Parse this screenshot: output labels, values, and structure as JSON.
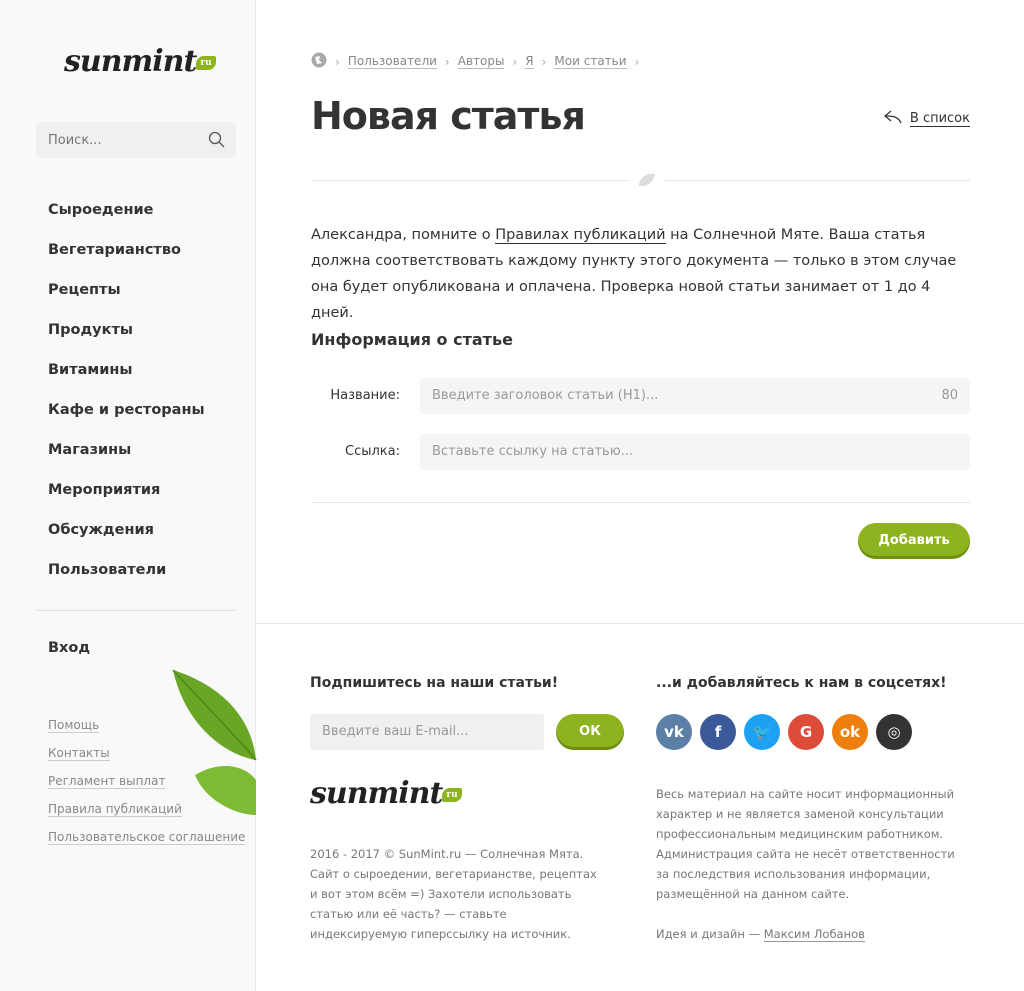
{
  "sidebar": {
    "logo": "sunmint",
    "logo_badge": "ru",
    "search_placeholder": "Поиск...",
    "nav": [
      "Сыроедение",
      "Вегетарианство",
      "Рецепты",
      "Продукты",
      "Витамины",
      "Кафе и рестораны",
      "Магазины",
      "Мероприятия",
      "Обсуждения",
      "Пользователи"
    ],
    "login": "Вход",
    "links": [
      "Помощь",
      "Контакты",
      "Регламент выплат",
      "Правила публикаций",
      "Пользовательское соглашение"
    ]
  },
  "breadcrumb": [
    "Пользователи",
    "Авторы",
    "Я",
    "Мои статьи"
  ],
  "page": {
    "title": "Новая статья",
    "back": "В список",
    "intro_before": "Александра, помните о ",
    "intro_link": "Правилах публикаций",
    "intro_after": " на Солнечной Мяте. Ваша статья должна соответствовать каждому пункту этого документа — только в этом случае она будет опубликована и оплачена. Проверка новой статьи занимает от 1 до 4 дней.",
    "section": "Информация о статье",
    "name_label": "Название:",
    "name_placeholder": "Введите заголовок статьи (H1)...",
    "name_counter": "80",
    "link_label": "Ссылка:",
    "link_placeholder": "Вставьте ссылку на статью...",
    "submit": "Добавить"
  },
  "footer": {
    "subscribe_title": "Подпишитесь на наши статьи!",
    "email_placeholder": "Введите ваш E-mail...",
    "ok": "ОК",
    "social_title": "...и добавляйтесь к нам в соцсетях!",
    "social": [
      {
        "name": "vk",
        "label": "vk",
        "color": "#5b7fa6"
      },
      {
        "name": "facebook",
        "label": "f",
        "color": "#3b5998"
      },
      {
        "name": "twitter",
        "label": "🐦",
        "color": "#1da1f2"
      },
      {
        "name": "google",
        "label": "G",
        "color": "#dd4b39"
      },
      {
        "name": "odnoklassniki",
        "label": "ok",
        "color": "#f07e0c"
      },
      {
        "name": "instagram",
        "label": "◎",
        "color": "#333333"
      }
    ],
    "copyright": "2016 - 2017 © SunMint.ru — Солнечная Мята.",
    "about": "Сайт о сыроедении, вегетарианстве, рецептах и вот этом всём =) Захотели использовать статью или её часть? — ставьте индексируемую гиперссылку на источник.",
    "disclaimer": "Весь материал на сайте носит информационный характер и не является заменой консультации профессиональным медицинским работником. Администрация сайта не несёт ответственности за последствия использования информации, размещённой на данном сайте.",
    "credit": "Идея и дизайн — ",
    "author": "Максим Лобанов"
  }
}
